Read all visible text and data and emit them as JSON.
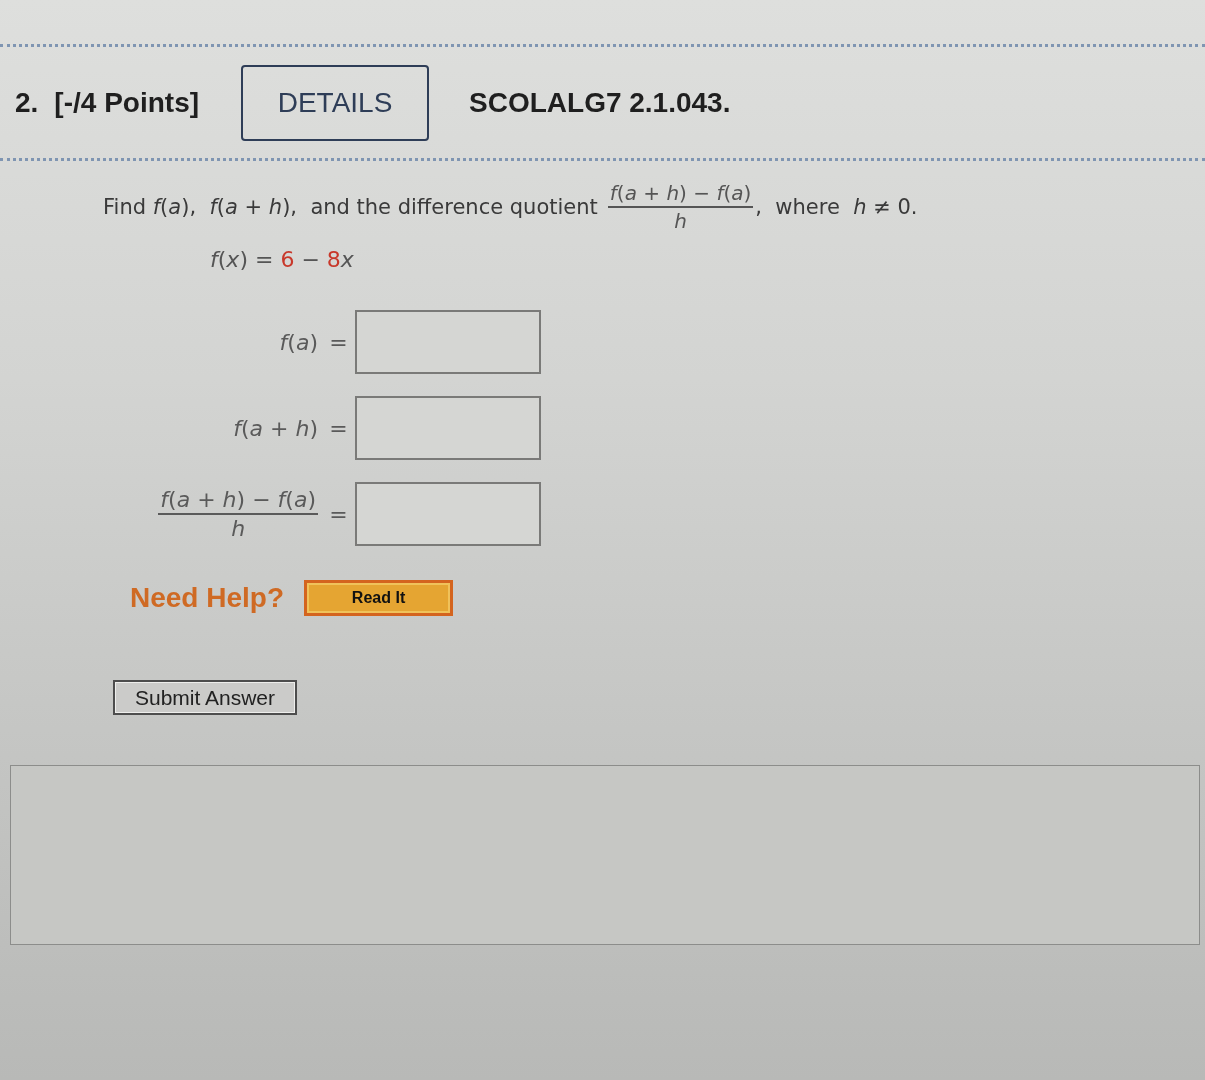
{
  "header": {
    "number": "2.",
    "points": "[-/4 Points]",
    "details_button": "DETAILS",
    "problem_id": "SCOLALG7 2.1.043."
  },
  "problem": {
    "text_before": "Find *f*(*a*),  *f*(*a* + *h*),  and the difference quotient",
    "fraction": {
      "numerator": "*f*(*a* + *h*) − *f*(*a*)",
      "denominator": "*h*"
    },
    "text_after": ",  where  *h* ≠ 0.",
    "function": [
      {
        "kind": "text",
        "text": "*f*(*x*) = "
      },
      {
        "kind": "value",
        "text": "6"
      },
      {
        "kind": "text",
        "text": " − "
      },
      {
        "kind": "value",
        "text": "8"
      },
      {
        "kind": "text",
        "text": "*x*"
      }
    ]
  },
  "answers": [
    {
      "kind": "expression",
      "label": "*f*(*a*)",
      "sign": "="
    },
    {
      "kind": "expression",
      "label": "*f*(*a* + *h*)",
      "sign": "="
    },
    {
      "kind": "fraction",
      "numerator": "*f*(*a* + *h*) − *f*(*a*)",
      "denominator": "*h*",
      "sign": "="
    }
  ],
  "help": {
    "label": "Need Help?",
    "buttons": [
      "Read It"
    ]
  },
  "submit_button": "Submit Answer"
}
